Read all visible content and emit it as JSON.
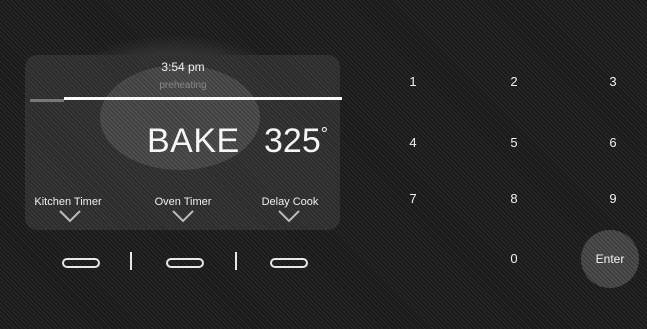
{
  "display": {
    "time": "3:54 pm",
    "status_line": "preheating",
    "mode": "BAKE",
    "temperature": "325",
    "degree_symbol": "°"
  },
  "options": [
    {
      "label": "Kitchen Timer"
    },
    {
      "label": "Oven Timer"
    },
    {
      "label": "Delay Cook"
    }
  ],
  "keypad": {
    "keys": [
      "1",
      "2",
      "3",
      "4",
      "5",
      "6",
      "7",
      "8",
      "9",
      "0"
    ],
    "enter_label": "Enter"
  }
}
